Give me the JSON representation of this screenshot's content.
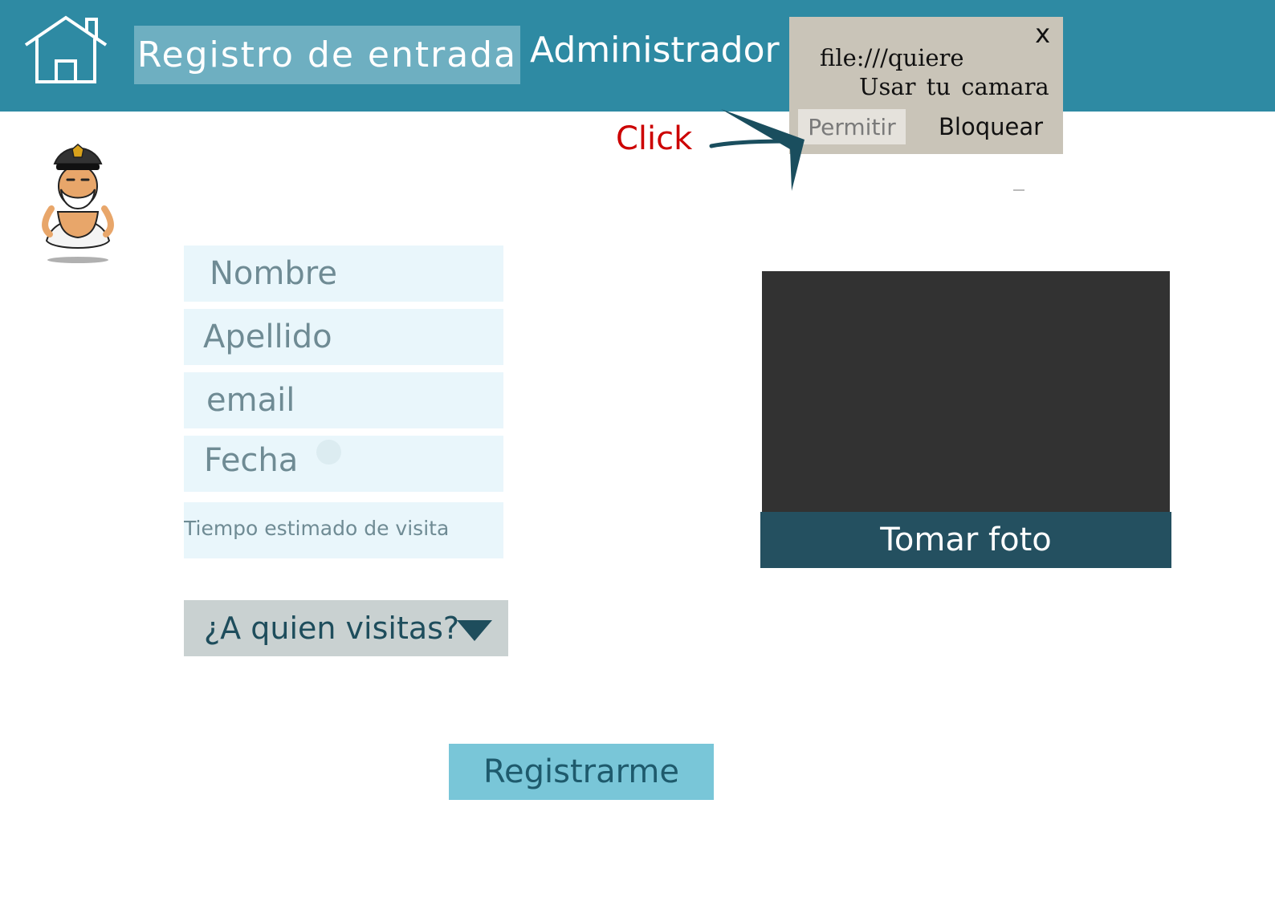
{
  "header": {
    "home_icon": "home-icon",
    "active_tab": "Registro de entrada",
    "admin_tab": "Administrador",
    "background": "#2e8aa3"
  },
  "permission_popup": {
    "close_label": "x",
    "line1": "file:///quiere",
    "line2": "Usar tu camara",
    "allow_label": "Permitir",
    "block_label": "Bloquear"
  },
  "annotation": {
    "click_label": "Click",
    "color": "#cc0000"
  },
  "mascot": {
    "icon": "police-mascot-icon"
  },
  "form": {
    "nombre_placeholder": "Nombre",
    "apellido_placeholder": "Apellido",
    "email_placeholder": "email",
    "fecha_placeholder": "Fecha",
    "tiempo_placeholder": "Tiempo estimado de visita",
    "visit_dropdown_label": "¿A quien visitas?",
    "register_label": "Registrarme"
  },
  "camera": {
    "take_photo_label": "Tomar foto"
  }
}
